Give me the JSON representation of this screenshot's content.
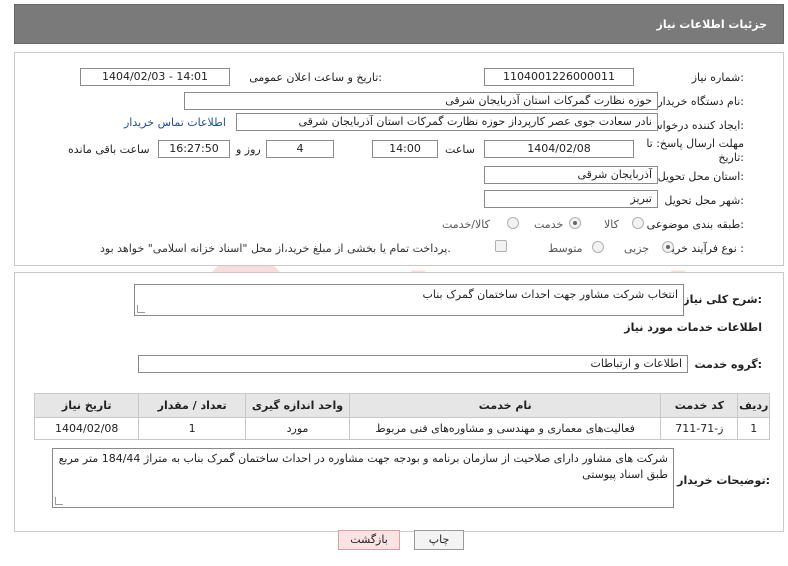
{
  "header": {
    "title": "جزئیات اطلاعات نیاز"
  },
  "form": {
    "need_number_label": "شماره نیاز:",
    "need_number": "1104001226000011",
    "announce_label": "تاریخ و ساعت اعلان عمومی:",
    "announce_value": "1404/02/03 - 14:01",
    "buyer_org_label": "نام دستگاه خریدار:",
    "buyer_org": "حوزه نظارت گمرکات استان آذربایجان شرقی",
    "creator_label": "ایجاد کننده درخواست:",
    "creator": "نادر سعادت جوی عصر کارپرداز حوزه نظارت گمرکات استان آذربایجان شرقی",
    "contact_link": "اطلاعات تماس خریدار",
    "deadline_label_1": "مهلت ارسال پاسخ: تا",
    "deadline_label_2": "تاریخ:",
    "deadline_date": "1404/02/08",
    "time_label": "ساعت",
    "deadline_time": "14:00",
    "days_value": "4",
    "days_label": "روز و",
    "remaining_time": "16:27:50",
    "remaining_label": "ساعت باقی مانده",
    "province_label": "استان محل تحویل:",
    "province": "آذربایجان شرقی",
    "city_label": "شهر محل تحویل:",
    "city": "تبریز",
    "category_label": "طبقه بندی موضوعی:",
    "category_options": [
      "کالا",
      "خدمت",
      "کالا/خدمت"
    ],
    "category_selected": "خدمت",
    "process_label": "نوع فرآیند خرید :",
    "process_options": [
      "جزیی",
      "متوسط"
    ],
    "process_selected": "جزیی",
    "payment_note": "پرداخت تمام یا بخشی از مبلغ خرید،از محل \"اسناد خزانه اسلامی\" خواهد بود."
  },
  "summary": {
    "label": "شرح کلی نیاز:",
    "value": "انتخاب شرکت مشاور جهت احداث ساختمان گمرک بناب"
  },
  "services": {
    "section_title": "اطلاعات خدمات مورد نیاز",
    "group_label": "گروه خدمت:",
    "group_value": "اطلاعات و ارتباطات",
    "table": {
      "headers": [
        "ردیف",
        "کد خدمت",
        "نام خدمت",
        "واحد اندازه گیری",
        "تعداد / مقدار",
        "تاریخ نیاز"
      ],
      "rows": [
        [
          "1",
          "ز-71-711",
          "فعالیت‌های معماری و مهندسی و مشاوره‌های فنی مربوط",
          "مورد",
          "1",
          "1404/02/08"
        ]
      ]
    }
  },
  "buyer_notes": {
    "label": "توضیحات خریدار:",
    "value": "شرکت های مشاور دارای صلاحیت از سازمان برنامه و بودجه جهت مشاوره در احداث ساختمان گمرک بناب به متراژ 184/44 متر مربع طبق اسناد پیوستی"
  },
  "buttons": {
    "print": "چاپ",
    "back": "بازگشت"
  },
  "watermark": {
    "text": "AriaTender.neT"
  }
}
